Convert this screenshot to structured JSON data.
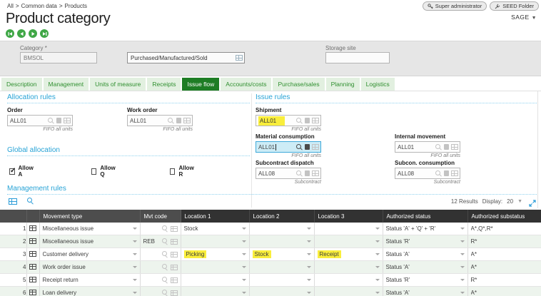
{
  "breadcrumb": {
    "items": [
      "All",
      "Common data",
      "Products"
    ],
    "separator": ">"
  },
  "header": {
    "title": "Product category",
    "session_button": "Super administrator",
    "folder_button": "SEED Folder",
    "brand": "SAGE"
  },
  "identity": {
    "category_label": "Category",
    "required_mark": "*",
    "category_value": "BMSOL",
    "category_description": "Purchased/Manufactured/Sold",
    "storage_site_label": "Storage site",
    "storage_site_value": ""
  },
  "tabs": {
    "active_index": 4,
    "items": [
      "Description",
      "Management",
      "Units of measure",
      "Receipts",
      "Issue flow",
      "Accounts/costs",
      "Purchase/sales",
      "Planning",
      "Logistics"
    ]
  },
  "allocation_rules": {
    "title": "Allocation rules",
    "fields": [
      {
        "label": "Order",
        "value": "ALL01",
        "caption": "FIFO all units"
      },
      {
        "label": "Work order",
        "value": "ALL01",
        "caption": "FIFO all units"
      }
    ]
  },
  "global_allocation": {
    "title": "Global allocation",
    "checkboxes": [
      {
        "label": "Allow A",
        "checked": true
      },
      {
        "label": "Allow Q",
        "checked": false
      },
      {
        "label": "Allow R",
        "checked": false
      }
    ]
  },
  "issue_rules": {
    "title": "Issue rules",
    "fields": [
      {
        "label": "Shipment",
        "value": "ALL01",
        "caption": "FIFO all units",
        "highlighted": true
      },
      {
        "label": "Material consumption",
        "value": "ALL01",
        "caption": "FIFO all units",
        "focused": true
      },
      {
        "label": "Internal movement",
        "value": "ALL01",
        "caption": "FIFO all units"
      },
      {
        "label": "Subcontract dispatch",
        "value": "ALL08",
        "caption": "Subcontract"
      },
      {
        "label": "Subcon. consumption",
        "value": "ALL08",
        "caption": "Subcontract"
      }
    ]
  },
  "management_rules": {
    "title": "Management rules",
    "results_count": "12 Results",
    "display_label": "Display:",
    "display_value": "20",
    "table": {
      "columns": [
        "Movement type",
        "Mvt code",
        "Location 1",
        "Location 2",
        "Location 3",
        "Authorized status",
        "Authorized substatus"
      ],
      "rows": [
        {
          "num": "1",
          "movement_type": "Miscellaneous issue",
          "mvt_code": "",
          "location1": "Stock",
          "location2": "",
          "location3": "",
          "status": "Status 'A' + 'Q' + 'R'",
          "substatus": "A*,Q*,R*",
          "highlights": []
        },
        {
          "num": "2",
          "movement_type": "Miscellaneous issue",
          "mvt_code": "REB",
          "location1": "",
          "location2": "",
          "location3": "",
          "status": "Status 'R'",
          "substatus": "R*",
          "highlights": []
        },
        {
          "num": "3",
          "movement_type": "Customer delivery",
          "mvt_code": "",
          "location1": "Picking",
          "location2": "Stock",
          "location3": "Receipt",
          "status": "Status 'A'",
          "substatus": "A*",
          "highlights": [
            "location1",
            "location2",
            "location3"
          ]
        },
        {
          "num": "4",
          "movement_type": "Work order issue",
          "mvt_code": "",
          "location1": "",
          "location2": "",
          "location3": "",
          "status": "Status 'A'",
          "substatus": "A*",
          "highlights": []
        },
        {
          "num": "5",
          "movement_type": "Receipt return",
          "mvt_code": "",
          "location1": "",
          "location2": "",
          "location3": "",
          "status": "Status 'R'",
          "substatus": "R*",
          "highlights": []
        },
        {
          "num": "6",
          "movement_type": "Loan delivery",
          "mvt_code": "",
          "location1": "",
          "location2": "",
          "location3": "",
          "status": "Status 'A'",
          "substatus": "A*",
          "highlights": []
        }
      ]
    }
  },
  "colors": {
    "accent_green": "#3fa746",
    "tab_active_green": "#1e7d25",
    "accent_blue": "#27a3d6",
    "highlight_yellow": "#f9ee3c",
    "table_header_dark": "#4d4d4d",
    "focus_field_bg": "#cdecf6"
  }
}
